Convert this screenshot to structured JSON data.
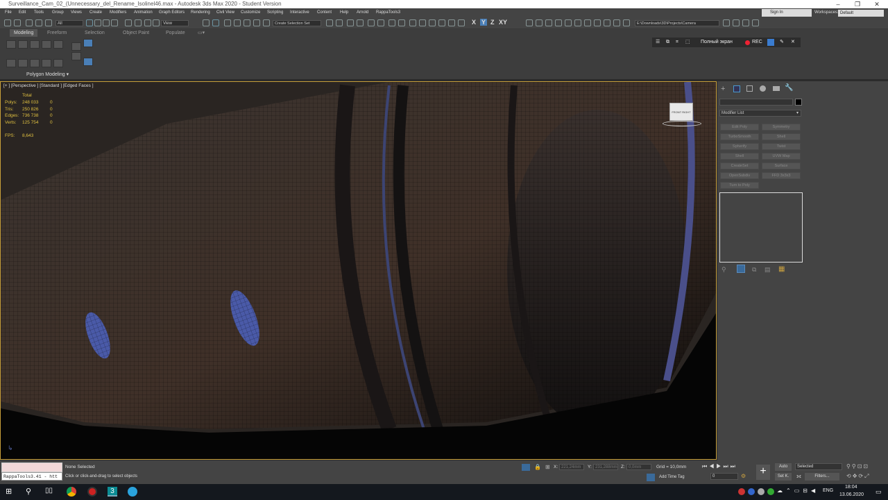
{
  "window": {
    "title": "Surveillance_Cam_02_(Unnecessary_del_Rename_Isolinel46.max - Autodesk 3ds Max 2020 - Student Version",
    "minimize": "–",
    "maximize": "❐",
    "close": "✕"
  },
  "menu": [
    "File",
    "Edit",
    "Tools",
    "Group",
    "Views",
    "Create",
    "Modifiers",
    "Animation",
    "Graph Editors",
    "Rendering",
    "Civil View",
    "Customize",
    "Scripting",
    "Interactive",
    "Content",
    "Help",
    "Arnold",
    "RappaTools3"
  ],
  "account": {
    "sign_in": "Sign In",
    "workspaces_label": "Workspaces:",
    "workspace": "Default"
  },
  "toolbar": {
    "selection_filter": "All",
    "ref_coord": "View",
    "create_selection_set": "Create Selection Set",
    "axis": [
      "X",
      "Y",
      "Z",
      "XY"
    ],
    "project_path": "E:\\Downloads\\3D\\Projects\\Camera"
  },
  "ribbon": {
    "tabs": [
      "Modeling",
      "Freeform",
      "Selection",
      "Object Paint",
      "Populate"
    ],
    "active_tab": "Modeling",
    "panel_label": "Polygon Modeling ▾"
  },
  "recorder": {
    "fullscreen": "Полный экран",
    "rec": "REC"
  },
  "viewport": {
    "label": "[+ ] [Perspective ] [Standard ] [Edged Faces ]",
    "stats": {
      "header": "Total",
      "rows": [
        {
          "label": "Polys:",
          "value": "248 033",
          "sel": "0"
        },
        {
          "label": "Tris:",
          "value": "250 826",
          "sel": "0"
        },
        {
          "label": "Edges:",
          "value": "736 738",
          "sel": "0"
        },
        {
          "label": "Verts:",
          "value": "125 754",
          "sel": "0"
        }
      ],
      "fps_label": "FPS:",
      "fps_value": "8,643"
    },
    "viewcube": {
      "front": "FRONT",
      "right": "RIGHT"
    }
  },
  "command_panel": {
    "modifier_list": "Modifier List",
    "buttons": [
      "Edit Poly",
      "Symmetry",
      "TurboSmooth",
      "Shell",
      "Spherify",
      "Twist",
      "Shell",
      "UVW Map",
      "CreateSet",
      "Surface",
      "OpenSubdiv",
      "FFD 3x3x3",
      "Turn to Poly"
    ]
  },
  "status": {
    "maxscript_output": "",
    "maxscript_input": "RappaTools3.41 - htt",
    "selection": "None Selected",
    "prompt": "Click or click-and-drag to select objects",
    "x_label": "X:",
    "x": "221,24mm",
    "y_label": "Y:",
    "y": "231,288mm",
    "z_label": "Z:",
    "z": "0,0mm",
    "grid": "Grid = 10,0mm",
    "add_time_tag": "Add Time Tag",
    "auto": "Auto",
    "set_key": "Set K.",
    "selected": "Selected",
    "filters": "Filters...",
    "frame": "0"
  },
  "taskbar": {
    "lang": "ENG",
    "time": "18:04",
    "date": "13.06.2020"
  }
}
